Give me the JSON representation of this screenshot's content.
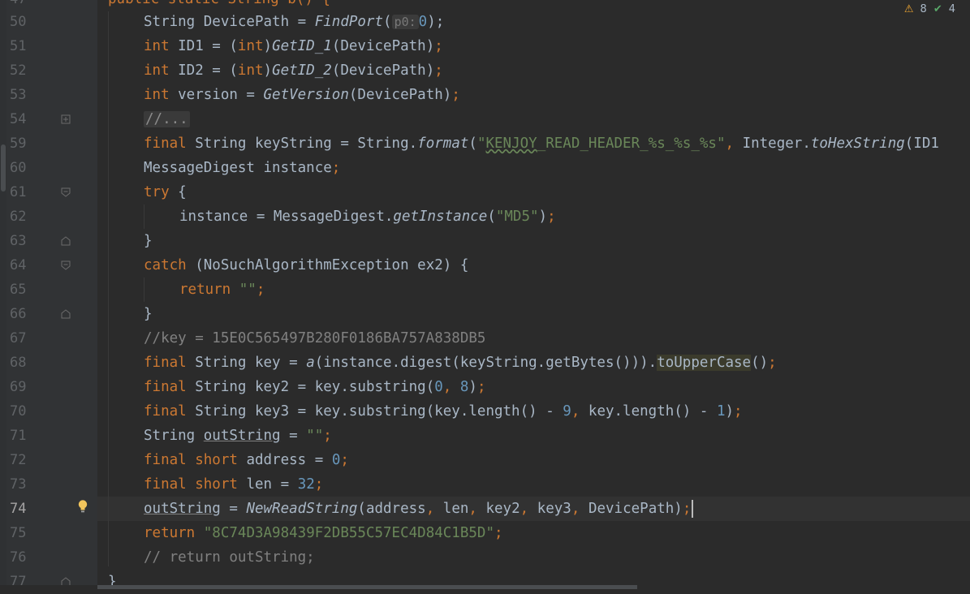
{
  "inspections": {
    "warnings": "8",
    "weak_warnings": "4"
  },
  "current_line": "74",
  "lines": [
    {
      "n": "50",
      "code": "String DevicePath = FindPort( p0: 0);"
    },
    {
      "n": "51",
      "code": "int ID1 = (int)GetID_1(DevicePath);"
    },
    {
      "n": "52",
      "code": "int ID2 = (int)GetID_2(DevicePath);"
    },
    {
      "n": "53",
      "code": "int version = GetVersion(DevicePath);"
    },
    {
      "n": "54",
      "code": "//..."
    },
    {
      "n": "59",
      "code": "final String keyString = String.format(\"KENJOY_READ_HEADER_%s_%s_%s\", Integer.toHexString(ID1"
    },
    {
      "n": "60",
      "code": "MessageDigest instance;"
    },
    {
      "n": "61",
      "code": "try {"
    },
    {
      "n": "62",
      "code": "instance = MessageDigest.getInstance(\"MD5\");"
    },
    {
      "n": "63",
      "code": "}"
    },
    {
      "n": "64",
      "code": "catch (NoSuchAlgorithmException ex2) {"
    },
    {
      "n": "65",
      "code": "return \"\";"
    },
    {
      "n": "66",
      "code": "}"
    },
    {
      "n": "67",
      "code": "//key = 15E0C565497B280F0186BA757A838DB5"
    },
    {
      "n": "68",
      "code": "final String key = a(instance.digest(keyString.getBytes())).toUpperCase();"
    },
    {
      "n": "69",
      "code": "final String key2 = key.substring(0, 8);"
    },
    {
      "n": "70",
      "code": "final String key3 = key.substring(key.length() - 9, key.length() - 1);"
    },
    {
      "n": "71",
      "code": "String outString = \"\";"
    },
    {
      "n": "72",
      "code": "final short address = 0;"
    },
    {
      "n": "73",
      "code": "final short len = 32;"
    },
    {
      "n": "74",
      "code": "outString = NewReadString(address, len, key2, key3, DevicePath);"
    },
    {
      "n": "75",
      "code": "return \"8C74D3A98439F2DB55C57EC4D84C1B5D\";"
    },
    {
      "n": "76",
      "code": "// return outString;"
    },
    {
      "n": "77",
      "code": "}"
    }
  ],
  "top_partial": {
    "n": "47",
    "code": "public static String b() {"
  },
  "tokens": {
    "l50": [
      "String DevicePath = ",
      "FindPort",
      "(",
      "p0:",
      "0",
      ");"
    ],
    "l51": [
      "int",
      " ID1 = (",
      "int",
      ")",
      "GetID_1",
      "(DevicePath)",
      ";"
    ],
    "l52": [
      "int",
      " ID2 = (",
      "int",
      ")",
      "GetID_2",
      "(DevicePath)",
      ";"
    ],
    "l53": [
      "int",
      " version = ",
      "GetVersion",
      "(DevicePath)",
      ";"
    ],
    "l54": [
      "//..."
    ],
    "l59": [
      "final",
      " String keyString = String.",
      "format",
      "(",
      "\"",
      "KENJOY",
      "_READ_HEADER_%s_%s_%s\"",
      ", ",
      "Integer.",
      "toHexString",
      "(ID1"
    ],
    "l60": [
      "MessageDigest instance",
      ";"
    ],
    "l61": [
      "try",
      " {"
    ],
    "l62": [
      "instance = MessageDigest.",
      "getInstance",
      "(",
      "\"MD5\"",
      ")",
      ";"
    ],
    "l63": [
      "}"
    ],
    "l64": [
      "catch",
      " (NoSuchAlgorithmException ex2) {"
    ],
    "l65": [
      "return",
      " ",
      "\"\"",
      ";"
    ],
    "l66": [
      "}"
    ],
    "l67": [
      "//key = 15E0C565497B280F0186BA757A838DB5"
    ],
    "l68": [
      "final",
      " String key = ",
      "a",
      "(instance.digest(keyString.getBytes())).",
      "toUpperCase",
      "()",
      ";"
    ],
    "l69": [
      "final",
      " String key2 = key.substring(",
      "0",
      ", ",
      "8",
      ")",
      ";"
    ],
    "l70": [
      "final",
      " String key3 = key.substring(key.length() - ",
      "9",
      ", ",
      "key.length() - ",
      "1",
      ")",
      ";"
    ],
    "l71": [
      "String ",
      "outString",
      " = ",
      "\"\"",
      ";"
    ],
    "l72": [
      "final",
      " ",
      "short",
      " address = ",
      "0",
      ";"
    ],
    "l73": [
      "final",
      " ",
      "short",
      " len = ",
      "32",
      ";"
    ],
    "l74": [
      "outString",
      " = ",
      "NewReadString",
      "(address",
      ", ",
      "len",
      ", ",
      "key2",
      ", ",
      "key3",
      ", ",
      "DevicePath)",
      ";"
    ],
    "l75": [
      "return",
      " ",
      "\"8C74D3A98439F2DB55C57EC4D84C1B5D\"",
      ";"
    ],
    "l76": [
      "// return outString;"
    ],
    "l77": [
      "}"
    ],
    "l47": [
      "public static String b() {"
    ]
  }
}
